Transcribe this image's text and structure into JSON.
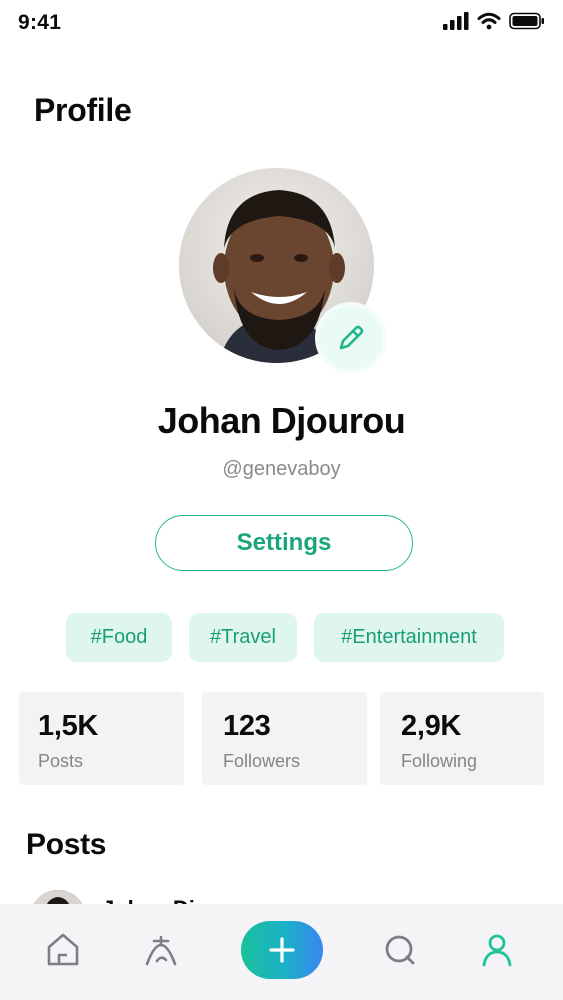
{
  "status_bar": {
    "time": "9:41"
  },
  "header": {
    "title": "Profile"
  },
  "profile": {
    "name": "Johan Djourou",
    "handle": "@genevaboy",
    "settings_label": "Settings",
    "tags": [
      "#Food",
      "#Travel",
      "#Entertainment"
    ]
  },
  "stats": [
    {
      "value": "1,5K",
      "label": "Posts"
    },
    {
      "value": "123",
      "label": "Followers"
    },
    {
      "value": "2,9K",
      "label": "Following"
    }
  ],
  "posts_section": {
    "title": "Posts",
    "first_author": "Johan Djourou"
  },
  "tab_bar": {
    "items": [
      "home-icon",
      "explore-icon",
      "add-icon",
      "search-icon",
      "profile-icon"
    ],
    "active": "profile-icon"
  },
  "colors": {
    "accent": "#1aa67c",
    "tag_bg": "#dff6ee",
    "stat_bg": "#f3f3f5",
    "tab_bar_bg": "#f4f4f6"
  }
}
